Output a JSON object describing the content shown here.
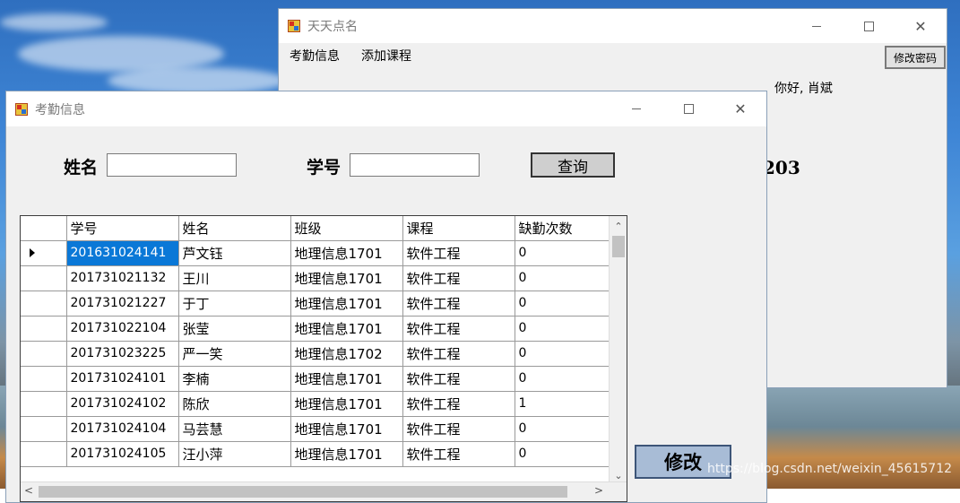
{
  "back_window": {
    "title": "天天点名",
    "menu": [
      "考勤信息",
      "添加课程"
    ],
    "change_password_label": "修改密码",
    "greeting": "你好, 肖斌",
    "partial_number": "203"
  },
  "front_window": {
    "title": "考勤信息",
    "name_label": "姓名",
    "name_value": "",
    "id_label": "学号",
    "id_value": "",
    "query_label": "查询",
    "edit_label": "修改",
    "grid": {
      "columns": [
        "学号",
        "姓名",
        "班级",
        "课程",
        "缺勤次数"
      ],
      "rows": [
        [
          "201631024141",
          "芦文钰",
          "地理信息1701",
          "软件工程",
          "0"
        ],
        [
          "201731021132",
          "王川",
          "地理信息1701",
          "软件工程",
          "0"
        ],
        [
          "201731021227",
          "于丁",
          "地理信息1701",
          "软件工程",
          "0"
        ],
        [
          "201731022104",
          "张莹",
          "地理信息1701",
          "软件工程",
          "0"
        ],
        [
          "201731023225",
          "严一笑",
          "地理信息1702",
          "软件工程",
          "0"
        ],
        [
          "201731024101",
          "李楠",
          "地理信息1701",
          "软件工程",
          "0"
        ],
        [
          "201731024102",
          "陈欣",
          "地理信息1701",
          "软件工程",
          "1"
        ],
        [
          "201731024104",
          "马芸慧",
          "地理信息1701",
          "软件工程",
          "0"
        ],
        [
          "201731024105",
          "汪小萍",
          "地理信息1701",
          "软件工程",
          "0"
        ]
      ],
      "selected_row": 0
    }
  },
  "watermark": "https://blog.csdn.net/weixin_45615712"
}
